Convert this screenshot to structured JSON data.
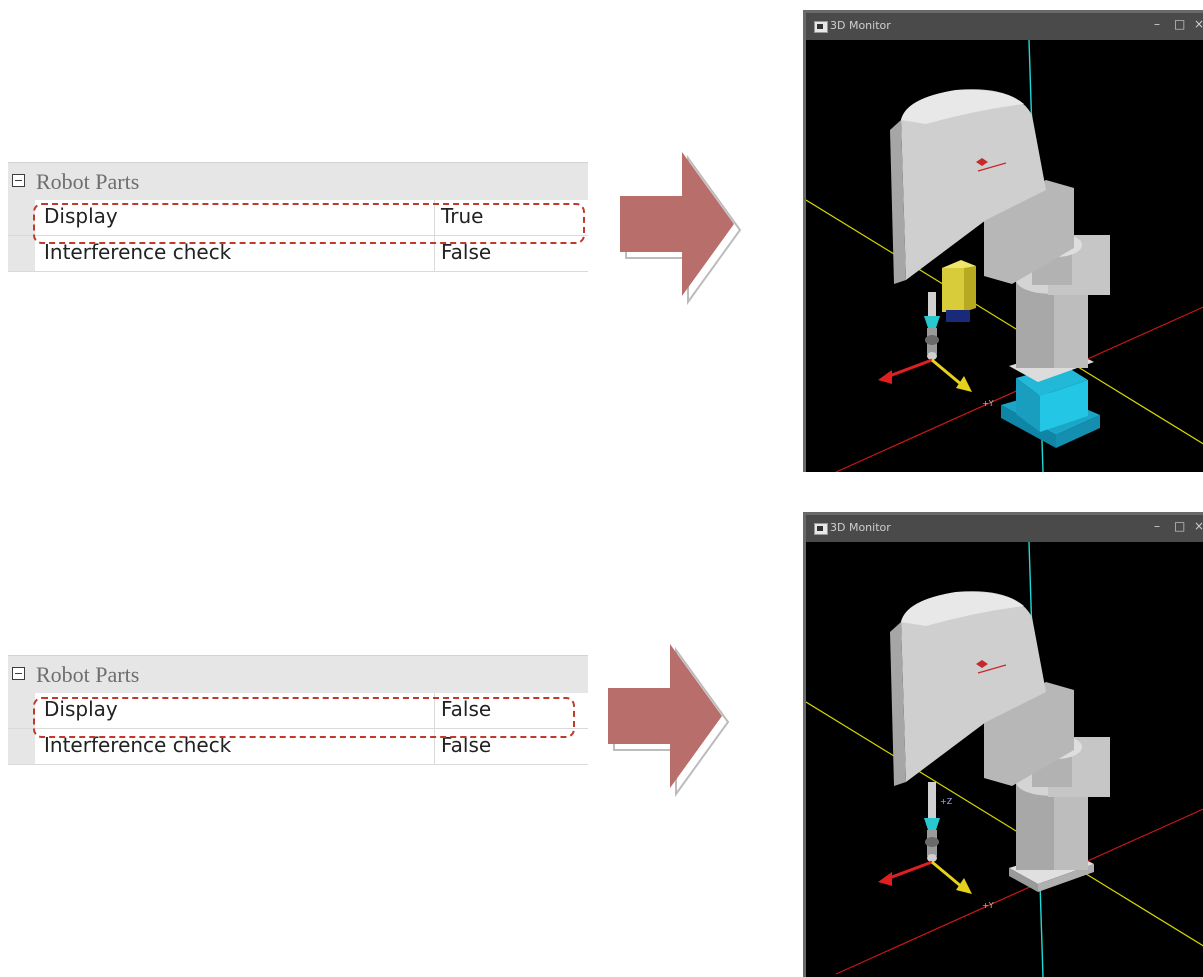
{
  "panel_top": {
    "category": "Robot Parts",
    "rows": [
      {
        "name": "Display",
        "value": "True"
      },
      {
        "name": "Interference check",
        "value": "False"
      }
    ]
  },
  "panel_bottom": {
    "category": "Robot Parts",
    "rows": [
      {
        "name": "Display",
        "value": "False"
      },
      {
        "name": "Interference check",
        "value": "False"
      }
    ]
  },
  "monitor_top": {
    "title": "3D Monitor",
    "minimize": "–",
    "maximize": "□",
    "close": "×",
    "axis_label": "+Y"
  },
  "monitor_bottom": {
    "title": "3D Monitor",
    "minimize": "–",
    "maximize": "□",
    "close": "×",
    "axis_label_z": "+Z",
    "axis_label": "+Y"
  },
  "colors": {
    "highlight": "#c0392b",
    "arrow": "#b86f6c",
    "robot_body": "#c8c8c8",
    "base_stand": "#22b8d8",
    "workpiece": "#d8cc3a"
  }
}
